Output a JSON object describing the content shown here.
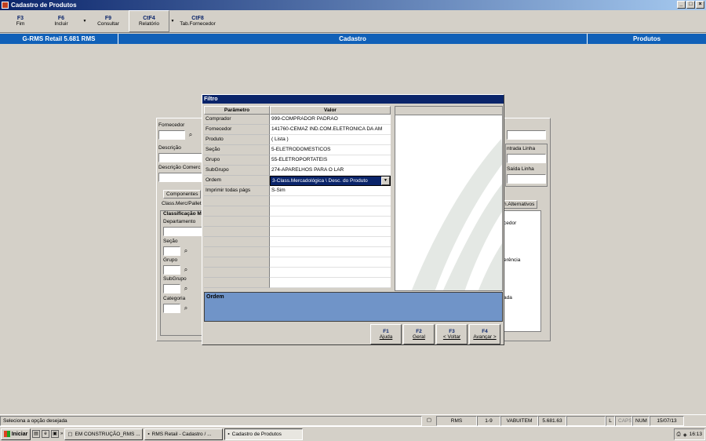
{
  "window": {
    "title": "Cadastro de Produtos"
  },
  "toolbar": [
    {
      "key": "F3",
      "label": "Fim"
    },
    {
      "key": "F6",
      "label": "Incluir"
    },
    {
      "key": "F9",
      "label": "Consultar"
    },
    {
      "key": "CtF4",
      "label": "Relatório"
    },
    {
      "key": "CtF8",
      "label": "Tab.Fornecedor"
    }
  ],
  "header": {
    "app": "G-RMS Retail 5.681 RMS",
    "center": "Cadastro",
    "right": "Produtos"
  },
  "background_form": {
    "fornecedor": "Fornecedor",
    "descricao": "Descrição",
    "descricao_comercial": "Descrição Comerc",
    "tab_componentes": "Componentes",
    "class_merc": "Class.Merc/Pallet",
    "classificacao": "Classificação M",
    "departamento": "Departamento",
    "secao": "Seção",
    "grupo": "Grupo",
    "subgrupo": "SubGrupo",
    "categoria": "Categoria",
    "entrada_linha": "ntrada Linha",
    "saida_linha": "Saída Linha",
    "alternativos": "n.Alternativos",
    "cedor": "cedor",
    "erencia": "erência",
    "ada": "ada"
  },
  "dialog": {
    "title": "Filtro",
    "col_param": "Parâmetro",
    "col_valor": "Valor",
    "rows": [
      {
        "param": "Comprador",
        "value": "999-COMPRADOR PADRAO"
      },
      {
        "param": "Fornecedor",
        "value": "141760-CEMAZ IND.COM.ELETRONICA DA AM"
      },
      {
        "param": "Produto",
        "value": "( Lista )"
      },
      {
        "param": "Seção",
        "value": "5-ELETRODOMESTICOS"
      },
      {
        "param": "Grupo",
        "value": "55-ELETROPORTATEIS"
      },
      {
        "param": "SubGrupo",
        "value": "274-APARELHOS PARA O LAR"
      },
      {
        "param": "Ordem",
        "value": "3-Class.Mercadológica \\ Desc. do Produto"
      },
      {
        "param": "Imprimir todas págs",
        "value": "S-Sim"
      }
    ],
    "ordem_label": "Ordem",
    "buttons": [
      {
        "key": "F1",
        "label": "Ajuda"
      },
      {
        "key": "F2",
        "label": "Geral"
      },
      {
        "key": "F3",
        "label": "< Voltar"
      },
      {
        "key": "F4",
        "label": "Avançar >"
      }
    ]
  },
  "statusbar": {
    "message": "Seleciona a opção desejada",
    "fields": [
      "RMS",
      "1-9",
      "VABUITEM",
      "5.681.63",
      "",
      "L",
      "CAPS",
      "NUM",
      "15/07/13"
    ]
  },
  "taskbar": {
    "start": "Iniciar",
    "tasks": [
      "EM CONSTRUÇÃO_RMS ...",
      "RMS Retail - Cadastro / ...",
      "Cadastro de Produtos"
    ],
    "clock": "16:13"
  }
}
